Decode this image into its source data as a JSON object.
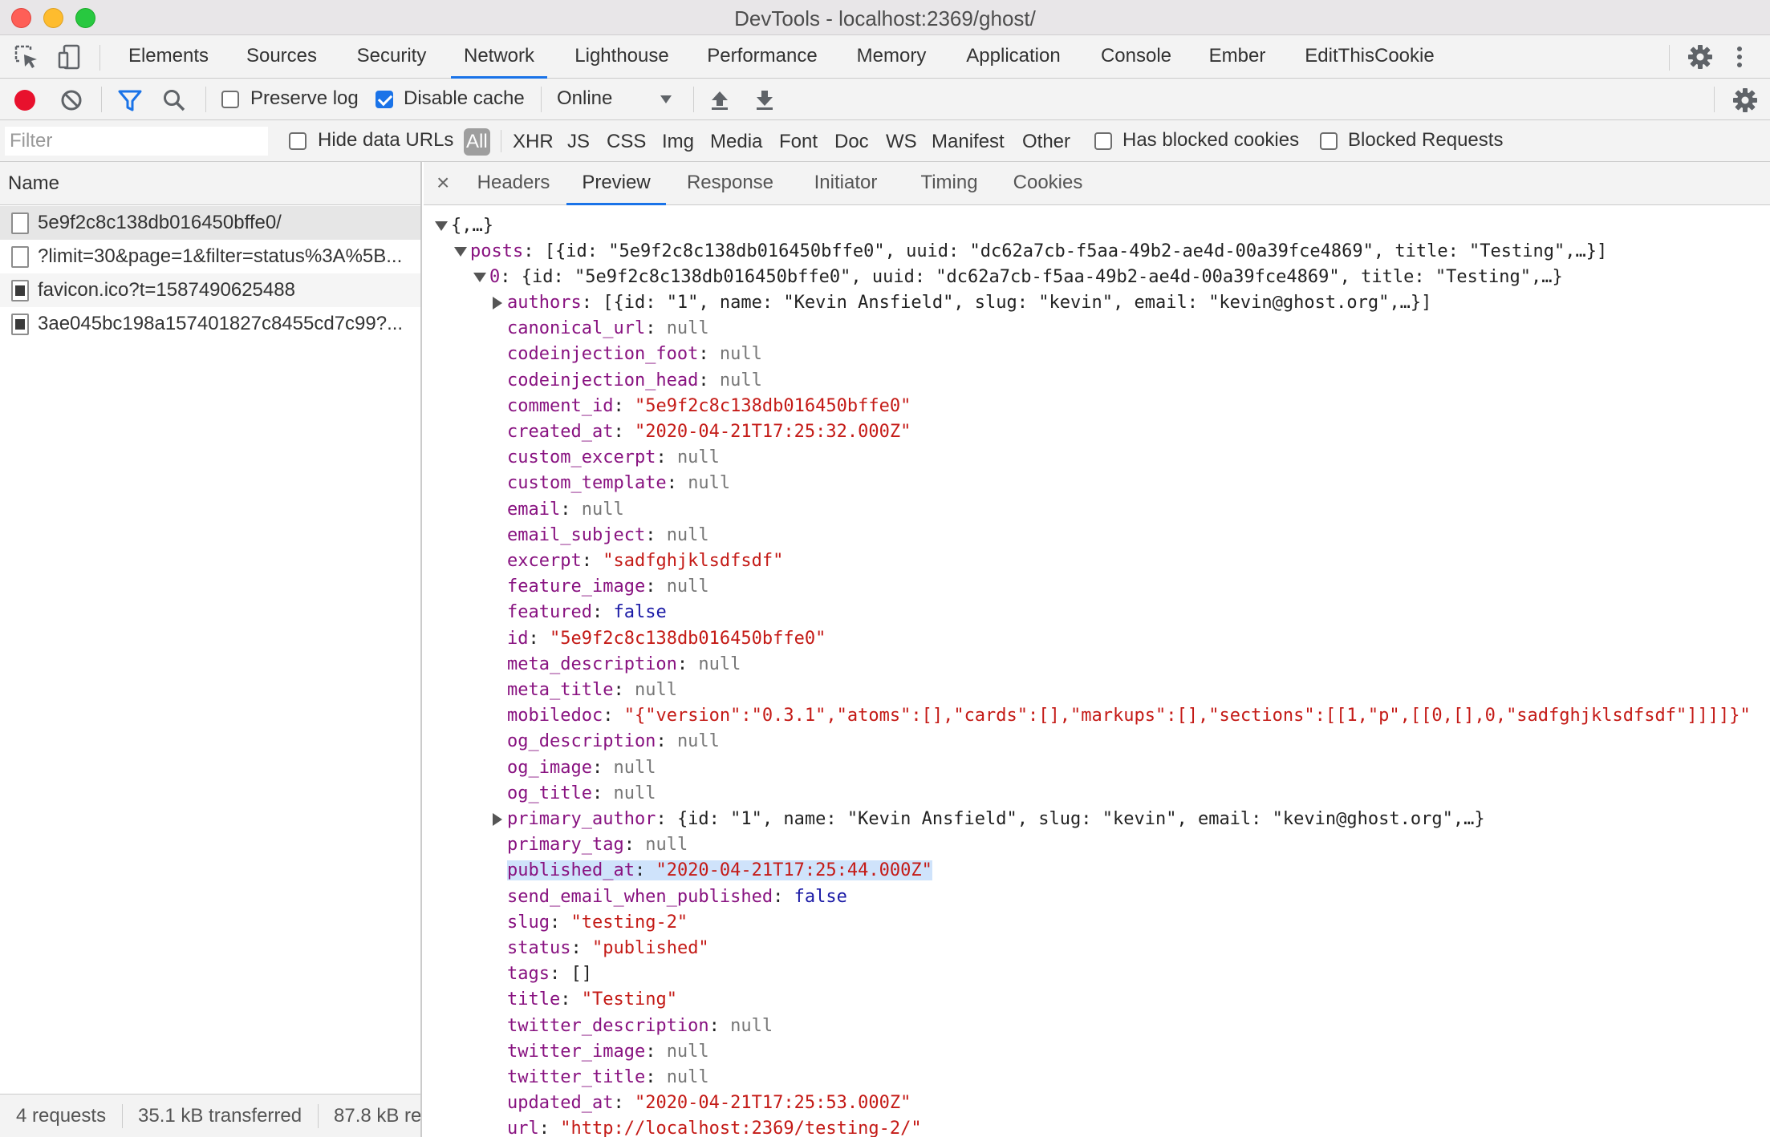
{
  "window": {
    "title": "DevTools - localhost:2369/ghost/"
  },
  "main_tabs": [
    {
      "label": "Elements"
    },
    {
      "label": "Sources"
    },
    {
      "label": "Security"
    },
    {
      "label": "Network"
    },
    {
      "label": "Lighthouse"
    },
    {
      "label": "Performance"
    },
    {
      "label": "Memory"
    },
    {
      "label": "Application"
    },
    {
      "label": "Console"
    },
    {
      "label": "Ember"
    },
    {
      "label": "EditThisCookie"
    }
  ],
  "active_main_tab": "Network",
  "toolbar": {
    "preserve_log_label": "Preserve log",
    "preserve_log_checked": false,
    "disable_cache_label": "Disable cache",
    "disable_cache_checked": true,
    "throttling_value": "Online"
  },
  "filter": {
    "placeholder": "Filter",
    "hide_data_urls_label": "Hide data URLs",
    "types": [
      "All",
      "XHR",
      "JS",
      "CSS",
      "Img",
      "Media",
      "Font",
      "Doc",
      "WS",
      "Manifest",
      "Other"
    ],
    "active_type": "All",
    "has_blocked_cookies_label": "Has blocked cookies",
    "blocked_requests_label": "Blocked Requests"
  },
  "requests": {
    "header": "Name",
    "items": [
      {
        "name": "5e9f2c8c138db016450bffe0/",
        "icon": "file-icon"
      },
      {
        "name": "?limit=30&page=1&filter=status%3A%5B...",
        "icon": "file-icon"
      },
      {
        "name": "favicon.ico?t=1587490625488",
        "icon": "image-icon"
      },
      {
        "name": "3ae045bc198a157401827c8455cd7c99?...",
        "icon": "image-icon"
      }
    ],
    "footer": {
      "requests": "4 requests",
      "transferred": "35.1 kB transferred",
      "resources": "87.8 kB re"
    }
  },
  "detail_tabs": [
    "Headers",
    "Preview",
    "Response",
    "Initiator",
    "Timing",
    "Cookies"
  ],
  "active_detail_tab": "Preview",
  "preview": {
    "root": "{,…}",
    "posts_key": "posts",
    "posts_summary": "[{id: \"5e9f2c8c138db016450bffe0\", uuid: \"dc62a7cb-f5aa-49b2-ae4d-00a39fce4869\", title: \"Testing\",…}]",
    "item0_key": "0",
    "item0_summary": "{id: \"5e9f2c8c138db016450bffe0\", uuid: \"dc62a7cb-f5aa-49b2-ae4d-00a39fce4869\", title: \"Testing\",…}",
    "fields": [
      {
        "key": "authors",
        "value": "[{id: \"1\", name: \"Kevin Ansfield\", slug: \"kevin\", email: \"kevin@ghost.org\",…}]",
        "type": "obj",
        "expandable": true
      },
      {
        "key": "canonical_url",
        "value": "null",
        "type": "null"
      },
      {
        "key": "codeinjection_foot",
        "value": "null",
        "type": "null"
      },
      {
        "key": "codeinjection_head",
        "value": "null",
        "type": "null"
      },
      {
        "key": "comment_id",
        "value": "\"5e9f2c8c138db016450bffe0\"",
        "type": "str"
      },
      {
        "key": "created_at",
        "value": "\"2020-04-21T17:25:32.000Z\"",
        "type": "str"
      },
      {
        "key": "custom_excerpt",
        "value": "null",
        "type": "null"
      },
      {
        "key": "custom_template",
        "value": "null",
        "type": "null"
      },
      {
        "key": "email",
        "value": "null",
        "type": "null"
      },
      {
        "key": "email_subject",
        "value": "null",
        "type": "null"
      },
      {
        "key": "excerpt",
        "value": "\"sadfghjklsdfsdf\"",
        "type": "str"
      },
      {
        "key": "feature_image",
        "value": "null",
        "type": "null"
      },
      {
        "key": "featured",
        "value": "false",
        "type": "bool"
      },
      {
        "key": "id",
        "value": "\"5e9f2c8c138db016450bffe0\"",
        "type": "str"
      },
      {
        "key": "meta_description",
        "value": "null",
        "type": "null"
      },
      {
        "key": "meta_title",
        "value": "null",
        "type": "null"
      },
      {
        "key": "mobiledoc",
        "value": "\"{\"version\":\"0.3.1\",\"atoms\":[],\"cards\":[],\"markups\":[],\"sections\":[[1,\"p\",[[0,[],0,\"sadfghjklsdfsdf\"]]]]}\"",
        "type": "str"
      },
      {
        "key": "og_description",
        "value": "null",
        "type": "null"
      },
      {
        "key": "og_image",
        "value": "null",
        "type": "null"
      },
      {
        "key": "og_title",
        "value": "null",
        "type": "null"
      },
      {
        "key": "primary_author",
        "value": "{id: \"1\", name: \"Kevin Ansfield\", slug: \"kevin\", email: \"kevin@ghost.org\",…}",
        "type": "obj",
        "expandable": true
      },
      {
        "key": "primary_tag",
        "value": "null",
        "type": "null"
      },
      {
        "key": "published_at",
        "value": "\"2020-04-21T17:25:44.000Z\"",
        "type": "str",
        "highlighted": true
      },
      {
        "key": "send_email_when_published",
        "value": "false",
        "type": "bool"
      },
      {
        "key": "slug",
        "value": "\"testing-2\"",
        "type": "str"
      },
      {
        "key": "status",
        "value": "\"published\"",
        "type": "str"
      },
      {
        "key": "tags",
        "value": "[]",
        "type": "obj"
      },
      {
        "key": "title",
        "value": "\"Testing\"",
        "type": "str"
      },
      {
        "key": "twitter_description",
        "value": "null",
        "type": "null"
      },
      {
        "key": "twitter_image",
        "value": "null",
        "type": "null"
      },
      {
        "key": "twitter_title",
        "value": "null",
        "type": "null"
      },
      {
        "key": "updated_at",
        "value": "\"2020-04-21T17:25:53.000Z\"",
        "type": "str"
      },
      {
        "key": "url",
        "value": "\"http://localhost:2369/testing-2/\"",
        "type": "str"
      }
    ]
  },
  "colors": {
    "accent": "#1a73e8",
    "record": "#e8112d",
    "json_key": "#881280",
    "json_string": "#c41a16",
    "json_bool": "#1a1aa6",
    "json_null": "#777777",
    "selection": "#cfe3fb"
  }
}
